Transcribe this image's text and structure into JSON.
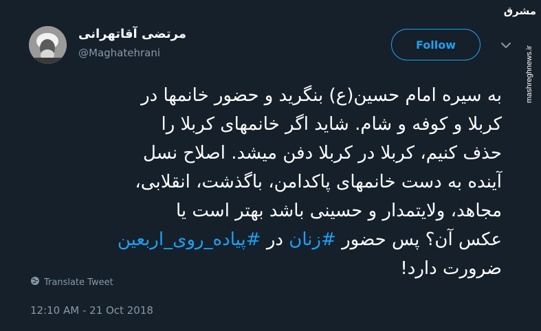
{
  "user": {
    "display_name": "مرتضی آقاتهرانی",
    "handle": "@Maghatehrani"
  },
  "actions": {
    "follow_label": "Follow"
  },
  "tweet": {
    "line1": "به سیره امام حسین(ع) بنگرید و حضور خانمها در",
    "line2": "کربلا و کوفه و شام. شاید اگر خانمهای کربلا را",
    "line3": "حذف کنیم، کربلا در کربلا دفن میشد. اصلاح نسل",
    "line4": "آینده به دست خانمهای پاکدامن، باگذشت، انقلابی،",
    "line5": "مجاهد، ولایتمدار و حسینی باشد بهتر است یا",
    "line6_a": "عکس آن؟ پس حضور",
    "hashtag1": "#زنان",
    "line6_b": "در",
    "hashtag2": "#پیاده_روی_اربعین",
    "line7": "ضرورت دارد!"
  },
  "translate_label": "Translate Tweet",
  "timestamp": "12:10 AM - 21 Oct 2018",
  "watermark": {
    "logo": "مشرق",
    "site": "mashreghnews.ir"
  },
  "icons": {
    "caret": "chevron-down-icon",
    "globe": "globe-icon"
  },
  "colors": {
    "background": "#15202b",
    "accent": "#1da1f2",
    "muted": "#8899a6"
  }
}
